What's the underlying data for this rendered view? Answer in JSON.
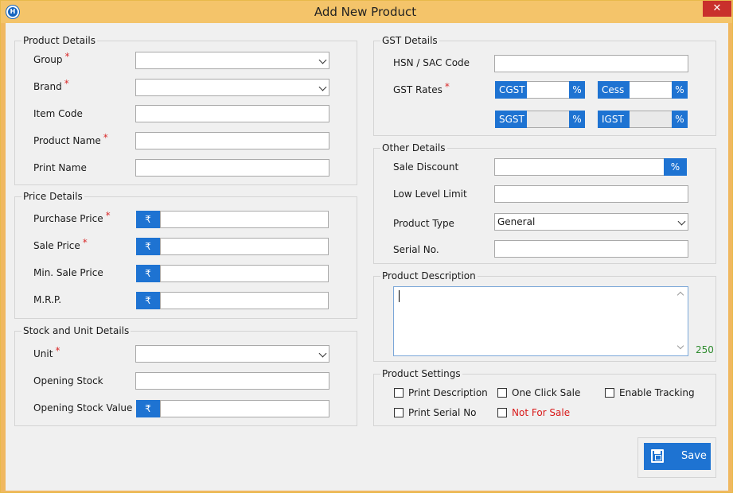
{
  "window": {
    "title": "Add New Product",
    "close_glyph": "✕",
    "app_icon_glyph": "H"
  },
  "product_details": {
    "title": "Product Details",
    "group_label": "Group",
    "brand_label": "Brand",
    "item_code_label": "Item Code",
    "product_name_label": "Product Name",
    "print_name_label": "Print Name"
  },
  "price_details": {
    "title": "Price Details",
    "currency": "₹",
    "purchase_price_label": "Purchase Price",
    "sale_price_label": "Sale Price",
    "min_sale_price_label": "Min. Sale Price",
    "mrp_label": "M.R.P."
  },
  "stock_details": {
    "title": "Stock and Unit Details",
    "unit_label": "Unit",
    "opening_stock_label": "Opening Stock",
    "opening_stock_value_label": "Opening Stock Value"
  },
  "gst_details": {
    "title": "GST Details",
    "hsn_label": "HSN / SAC Code",
    "gst_rates_label": "GST Rates",
    "cgst": "CGST",
    "cess": "Cess",
    "sgst": "SGST",
    "igst": "IGST",
    "percent": "%"
  },
  "other_details": {
    "title": "Other Details",
    "sale_discount_label": "Sale Discount",
    "low_level_label": "Low Level Limit",
    "product_type_label": "Product Type",
    "product_type_value": "General",
    "serial_no_label": "Serial No."
  },
  "description": {
    "title": "Product Description",
    "counter": "250"
  },
  "settings": {
    "title": "Product Settings",
    "print_description": "Print Description",
    "one_click_sale": "One Click Sale",
    "enable_tracking": "Enable Tracking",
    "print_serial_no": "Print Serial No",
    "not_for_sale": "Not For Sale"
  },
  "required_mark": "*",
  "save_label": "Save",
  "colors": {
    "accent": "#1e73d2",
    "title_bar": "#f4c46a",
    "close": "#c9302c",
    "required": "#d92b2b",
    "counter": "#2e8b2e"
  }
}
